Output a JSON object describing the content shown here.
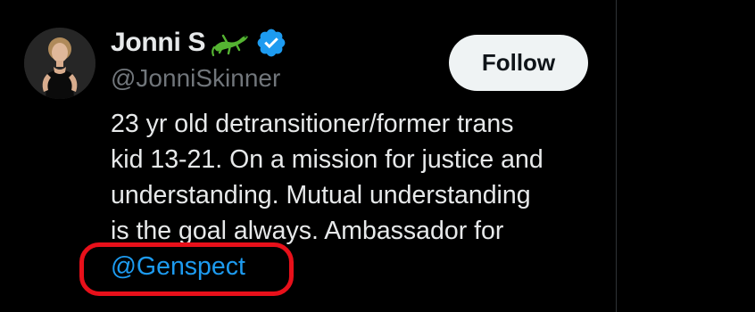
{
  "profile": {
    "display_name": "Jonni S",
    "handle": "@JonniSkinner",
    "name_emoji_icon": "lizard-icon",
    "verified_icon": "verified-badge-icon",
    "avatar_icon": "profile-photo"
  },
  "actions": {
    "follow_label": "Follow"
  },
  "bio": {
    "lines": [
      "23 yr old detransitioner/former trans",
      "kid 13-21. On a mission for justice and",
      "understanding. Mutual understanding",
      "is the goal always. Ambassador for"
    ],
    "mention": "@Genspect"
  },
  "colors": {
    "background": "#000000",
    "text": "#e7e9ea",
    "secondary_text": "#71767b",
    "link": "#1d9bf0",
    "verified": "#1d9bf0",
    "follow_bg": "#eff3f4",
    "highlight": "#e8101a"
  }
}
